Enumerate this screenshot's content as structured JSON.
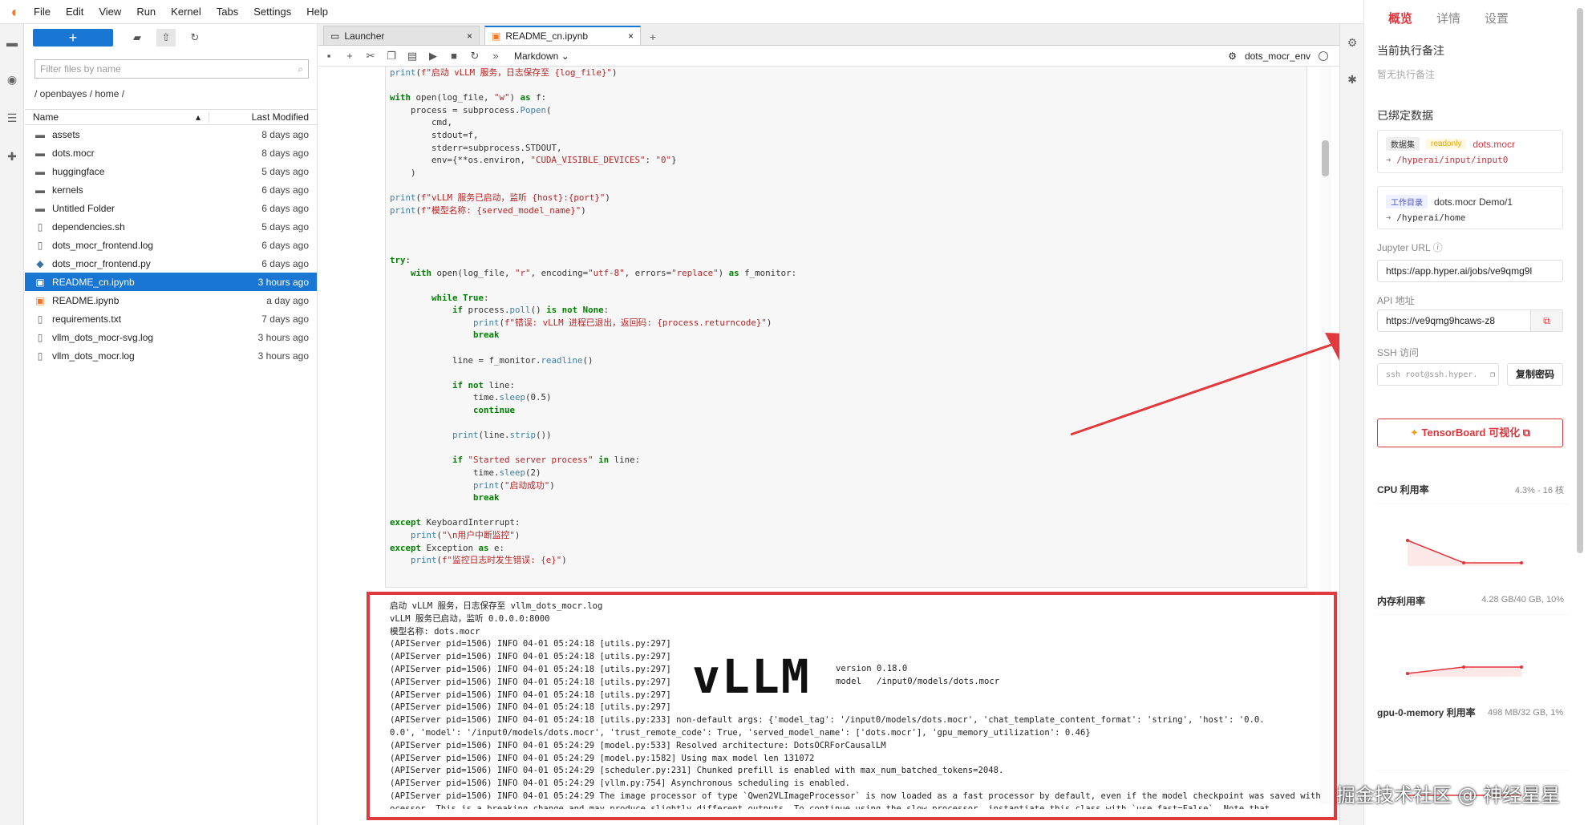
{
  "menubar": {
    "items": [
      "File",
      "Edit",
      "View",
      "Run",
      "Kernel",
      "Tabs",
      "Settings",
      "Help"
    ]
  },
  "filebrowser": {
    "new_label": "+",
    "filter_placeholder": "Filter files by name",
    "breadcrumb": "/ openbayes / home /",
    "col_name": "Name",
    "col_modified": "Last Modified",
    "files": [
      {
        "name": "assets",
        "modified": "8 days ago",
        "kind": "folder"
      },
      {
        "name": "dots.mocr",
        "modified": "8 days ago",
        "kind": "folder"
      },
      {
        "name": "huggingface",
        "modified": "5 days ago",
        "kind": "folder"
      },
      {
        "name": "kernels",
        "modified": "6 days ago",
        "kind": "folder"
      },
      {
        "name": "Untitled Folder",
        "modified": "6 days ago",
        "kind": "folder"
      },
      {
        "name": "dependencies.sh",
        "modified": "5 days ago",
        "kind": "file"
      },
      {
        "name": "dots_mocr_frontend.log",
        "modified": "6 days ago",
        "kind": "file"
      },
      {
        "name": "dots_mocr_frontend.py",
        "modified": "6 days ago",
        "kind": "python"
      },
      {
        "name": "README_cn.ipynb",
        "modified": "3 hours ago",
        "kind": "notebook"
      },
      {
        "name": "README.ipynb",
        "modified": "a day ago",
        "kind": "notebook"
      },
      {
        "name": "requirements.txt",
        "modified": "7 days ago",
        "kind": "file"
      },
      {
        "name": "vllm_dots_mocr-svg.log",
        "modified": "3 hours ago",
        "kind": "file"
      },
      {
        "name": "vllm_dots_mocr.log",
        "modified": "3 hours ago",
        "kind": "file"
      }
    ]
  },
  "tabs": [
    {
      "label": "Launcher"
    },
    {
      "label": "README_cn.ipynb"
    }
  ],
  "notebook": {
    "cell_type": "Markdown",
    "kernel_name": "dots_mocr_env"
  },
  "output": {
    "vllm_logo": "vLLM",
    "vllm_version_line": "version 0.18.0",
    "vllm_model_line": "model   /input0/models/dots.mocr"
  },
  "side_panel": {
    "tabs": [
      "概览",
      "详情",
      "设置"
    ],
    "current_note_title": "当前执行备注",
    "current_note_empty": "暂无执行备注",
    "bound_data_title": "已绑定数据",
    "dataset_badge": "数据集",
    "readonly_badge": "readonly",
    "dataset_name": "dots.mocr",
    "dataset_path": "/hyperai/input/input0",
    "workdir_badge": "工作目录",
    "workdir_name": "dots.mocr Demo/1",
    "workdir_path": "/hyperai/home",
    "jupyter_url_label": "Jupyter URL",
    "jupyter_url": "https://app.hyper.ai/jobs/ve9qmg9l",
    "api_label": "API 地址",
    "api_url": "https://ve9qmg9hcaws-z8",
    "ssh_label": "SSH 访问",
    "ssh_cmd": "ssh root@ssh.hyper.",
    "copy_pwd": "复制密码",
    "tensorboard": "TensorBoard 可视化",
    "cpu_title": "CPU 利用率",
    "cpu_value": "4.3% - 16 核",
    "mem_title": "内存利用率",
    "mem_value": "4.28 GB/40 GB, 10%",
    "gpu_title": "gpu-0-memory 利用率",
    "gpu_value": "498 MB/32 GB, 1%"
  },
  "watermark": "掘金技术社区 @ 神经星星",
  "colors": {
    "accent": "#1976d2",
    "highlight_red": "#e03a3e",
    "brand_red": "#e0343b"
  }
}
